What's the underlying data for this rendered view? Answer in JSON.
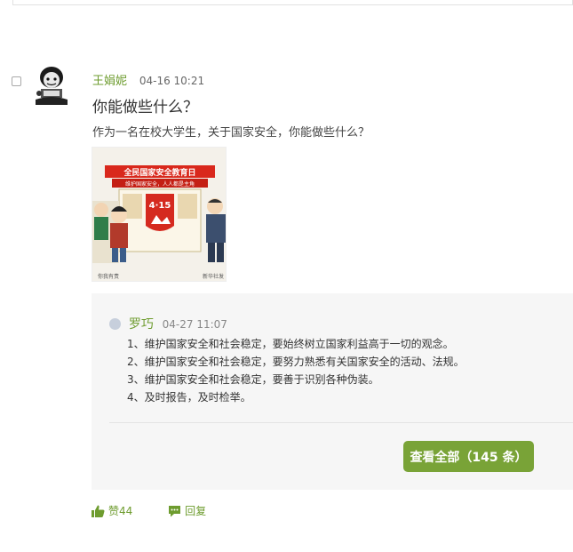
{
  "post": {
    "author": "王娟妮",
    "time": "04-16 10:21",
    "title": "你能做些什么？",
    "body": "作为一名在校大学生，关于国家安全，你能做些什么？",
    "image": {
      "banner_title": "全民国家安全教育日",
      "banner_sub": "维护国家安全，人人都是主角",
      "badge": "4·15",
      "caption_left": "你我有责",
      "caption_right": "新华社发"
    }
  },
  "reply": {
    "author": "罗巧",
    "time": "04-27 11:07",
    "lines": [
      "1、维护国家安全和社会稳定，要始终树立国家利益高于一切的观念。",
      "2、维护国家安全和社会稳定，要努力熟悉有关国家安全的活动、法规。",
      "3、维护国家安全和社会稳定，要善于识别各种伪装。",
      "4、及时报告，及时检举。"
    ],
    "view_all": "查看全部（145 条）"
  },
  "actions": {
    "like_label": "赞44",
    "reply_label": "回复"
  },
  "colors": {
    "accent": "#6e9c2f",
    "button": "#79a337",
    "reply_bg": "#f6f6f6"
  }
}
